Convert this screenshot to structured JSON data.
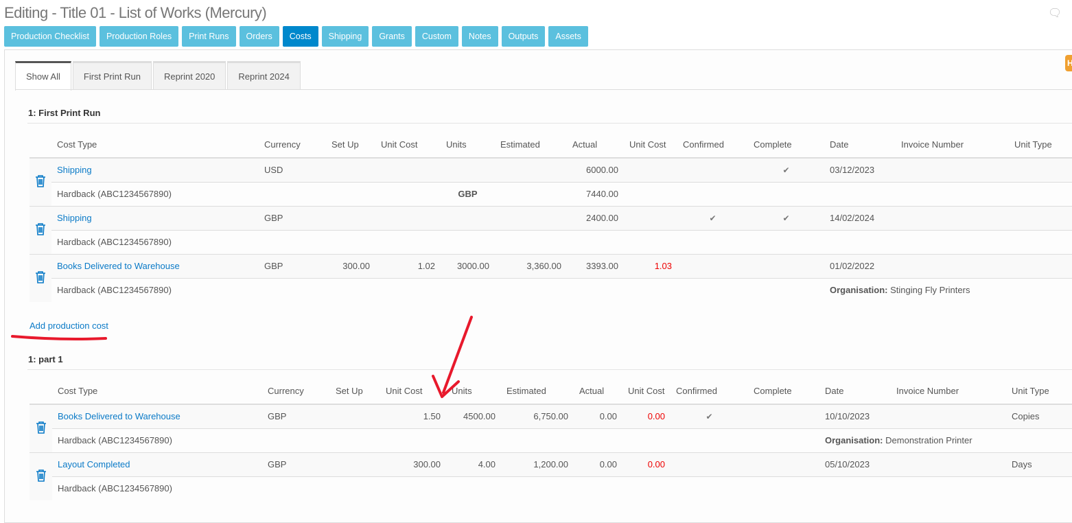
{
  "page": {
    "title": "Editing - Title 01 - List of Works (Mercury)",
    "badge": "H"
  },
  "nav": [
    {
      "label": "Production Checklist"
    },
    {
      "label": "Production Roles"
    },
    {
      "label": "Print Runs"
    },
    {
      "label": "Orders"
    },
    {
      "label": "Costs",
      "active": true
    },
    {
      "label": "Shipping"
    },
    {
      "label": "Grants"
    },
    {
      "label": "Custom"
    },
    {
      "label": "Notes"
    },
    {
      "label": "Outputs"
    },
    {
      "label": "Assets"
    }
  ],
  "tabs": [
    {
      "label": "Show All",
      "active": true
    },
    {
      "label": "First Print Run"
    },
    {
      "label": "Reprint 2020"
    },
    {
      "label": "Reprint 2024"
    }
  ],
  "columns": [
    "Cost Type",
    "Currency",
    "Set Up",
    "Unit Cost",
    "Units",
    "Estimated",
    "Actual",
    "Unit Cost",
    "Confirmed",
    "Complete",
    "Date",
    "Invoice Number",
    "Unit Type"
  ],
  "add_cost_label": "Add production cost",
  "organisation_label": "Organisation:",
  "colors": {
    "accent": "#5bc0de",
    "active": "#0088cc",
    "link": "#0a7ac7",
    "warning": "#e00000",
    "annotation": "#e8192c"
  },
  "sections": [
    {
      "title": "1: First Print Run",
      "rows": [
        {
          "cost_type": "Shipping",
          "currency": "USD",
          "setup": "",
          "unit_cost": "",
          "units": "",
          "estimated": "",
          "actual": "6000.00",
          "unit_cost2": "",
          "confirmed": false,
          "complete": true,
          "date": "03/12/2023",
          "invoice": "",
          "unit_type": "",
          "product": "Hardback (ABC1234567890)",
          "sub_currency": "GBP",
          "sub_actual": "7440.00",
          "organisation": ""
        },
        {
          "cost_type": "Shipping",
          "currency": "GBP",
          "setup": "",
          "unit_cost": "",
          "units": "",
          "estimated": "",
          "actual": "2400.00",
          "unit_cost2": "",
          "confirmed": true,
          "complete": true,
          "date": "14/02/2024",
          "invoice": "",
          "unit_type": "",
          "product": "Hardback (ABC1234567890)",
          "sub_currency": "",
          "sub_actual": "",
          "organisation": ""
        },
        {
          "cost_type": "Books Delivered to Warehouse",
          "currency": "GBP",
          "setup": "300.00",
          "unit_cost": "1.02",
          "units": "3000.00",
          "estimated": "3,360.00",
          "actual": "3393.00",
          "unit_cost2": "1.03",
          "confirmed": false,
          "complete": false,
          "date": "01/02/2022",
          "invoice": "",
          "unit_type": "",
          "product": "Hardback (ABC1234567890)",
          "sub_currency": "",
          "sub_actual": "",
          "organisation": "Stinging Fly Printers"
        }
      ]
    },
    {
      "title": "1: part 1",
      "rows": [
        {
          "cost_type": "Books Delivered to Warehouse",
          "currency": "GBP",
          "setup": "",
          "unit_cost": "1.50",
          "units": "4500.00",
          "estimated": "6,750.00",
          "actual": "0.00",
          "unit_cost2": "0.00",
          "confirmed": true,
          "complete": false,
          "date": "10/10/2023",
          "invoice": "",
          "unit_type": "Copies",
          "product": "Hardback (ABC1234567890)",
          "sub_currency": "",
          "sub_actual": "",
          "organisation": "Demonstration Printer"
        },
        {
          "cost_type": "Layout Completed",
          "currency": "GBP",
          "setup": "",
          "unit_cost": "300.00",
          "units": "4.00",
          "estimated": "1,200.00",
          "actual": "0.00",
          "unit_cost2": "0.00",
          "confirmed": false,
          "complete": false,
          "date": "05/10/2023",
          "invoice": "",
          "unit_type": "Days",
          "product": "Hardback (ABC1234567890)",
          "sub_currency": "",
          "sub_actual": "",
          "organisation": ""
        }
      ]
    }
  ]
}
